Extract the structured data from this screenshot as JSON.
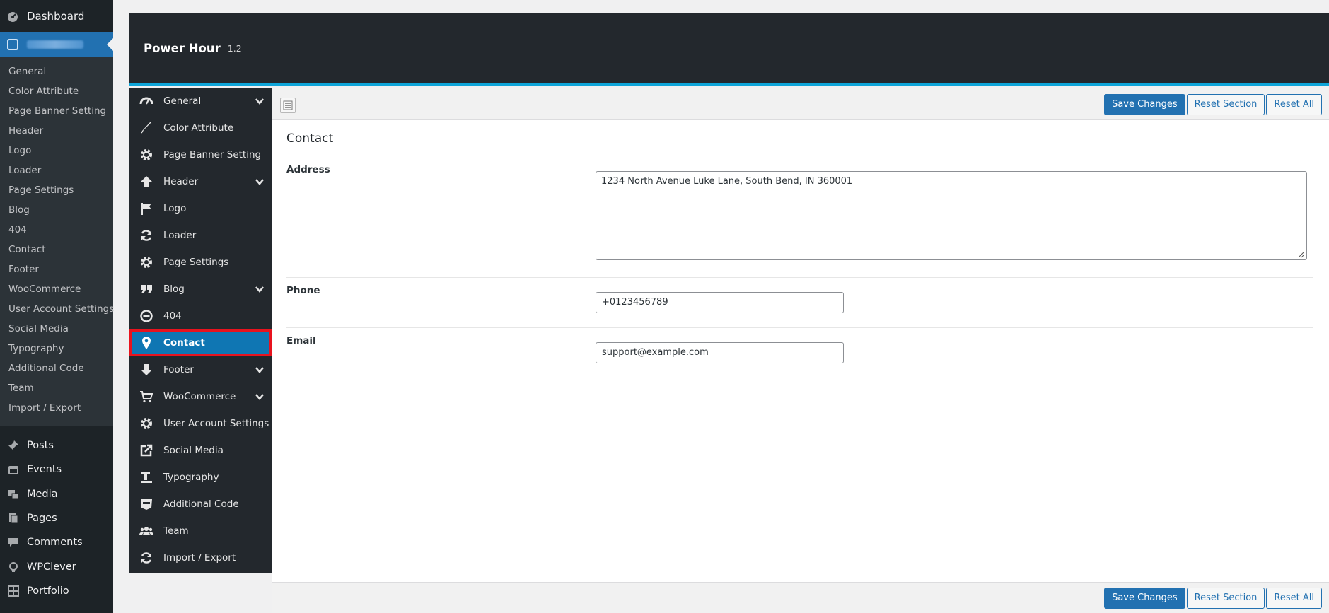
{
  "wp_sidebar": {
    "dashboard_label": "Dashboard",
    "submenu": [
      "General",
      "Color Attribute",
      "Page Banner Setting",
      "Header",
      "Logo",
      "Loader",
      "Page Settings",
      "Blog",
      "404",
      "Contact",
      "Footer",
      "WooCommerce",
      "User Account Settings",
      "Social Media",
      "Typography",
      "Additional Code",
      "Team",
      "Import / Export"
    ],
    "menu": [
      {
        "label": "Posts",
        "icon": "pin-icon"
      },
      {
        "label": "Events",
        "icon": "events-icon"
      },
      {
        "label": "Media",
        "icon": "media-icon"
      },
      {
        "label": "Pages",
        "icon": "pages-icon"
      },
      {
        "label": "Comments",
        "icon": "comment-icon"
      },
      {
        "label": "WPClever",
        "icon": "bulb-icon"
      },
      {
        "label": "Portfolio",
        "icon": "grid-icon"
      }
    ]
  },
  "panel": {
    "title": "Power Hour",
    "version": "1.2",
    "nav": [
      {
        "label": "General",
        "icon": "dashboard-gauge-icon",
        "expandable": true
      },
      {
        "label": "Color Attribute",
        "icon": "brush-icon",
        "expandable": false
      },
      {
        "label": "Page Banner Setting",
        "icon": "gear-icon",
        "expandable": false
      },
      {
        "label": "Header",
        "icon": "arrow-up-icon",
        "expandable": true
      },
      {
        "label": "Logo",
        "icon": "flag-icon",
        "expandable": false
      },
      {
        "label": "Loader",
        "icon": "refresh-icon",
        "expandable": false
      },
      {
        "label": "Page Settings",
        "icon": "gear-icon",
        "expandable": false
      },
      {
        "label": "Blog",
        "icon": "quote-icon",
        "expandable": true
      },
      {
        "label": "404",
        "icon": "minus-circle-icon",
        "expandable": false
      },
      {
        "label": "Contact",
        "icon": "map-pin-icon",
        "expandable": false,
        "active": true
      },
      {
        "label": "Footer",
        "icon": "arrow-down-icon",
        "expandable": true
      },
      {
        "label": "WooCommerce",
        "icon": "cart-icon",
        "expandable": true
      },
      {
        "label": "User Account Settings",
        "icon": "gear-icon",
        "expandable": false
      },
      {
        "label": "Social Media",
        "icon": "share-icon",
        "expandable": false
      },
      {
        "label": "Typography",
        "icon": "text-height-icon",
        "expandable": false
      },
      {
        "label": "Additional Code",
        "icon": "css-icon",
        "expandable": false
      },
      {
        "label": "Team",
        "icon": "users-icon",
        "expandable": false
      },
      {
        "label": "Import / Export",
        "icon": "refresh-icon",
        "expandable": false
      }
    ],
    "toolbar": {
      "save": "Save Changes",
      "reset_section": "Reset Section",
      "reset_all": "Reset All"
    },
    "section_title": "Contact",
    "fields": {
      "address": {
        "label": "Address",
        "value": "1234 North Avenue Luke Lane, South Bend, IN 360001"
      },
      "phone": {
        "label": "Phone",
        "value": "+0123456789"
      },
      "email": {
        "label": "Email",
        "value": "support@example.com"
      }
    }
  }
}
